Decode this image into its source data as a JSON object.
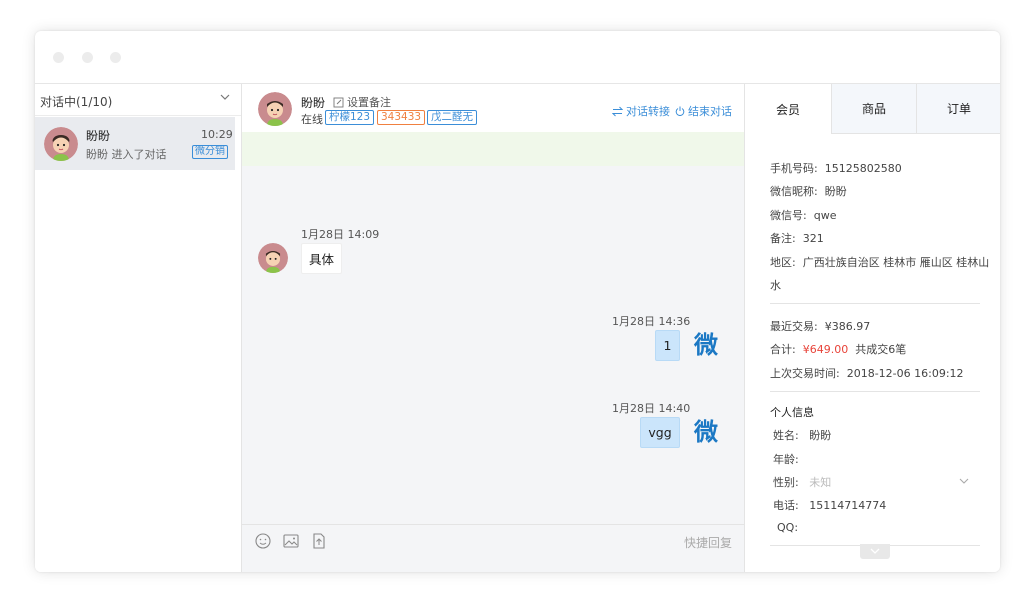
{
  "window": {
    "dots": [
      "",
      "",
      ""
    ]
  },
  "sidebar": {
    "header_label": "对话中(1/10)",
    "conversation": {
      "name": "盼盼",
      "time": "10:29",
      "message": "盼盼 进入了对话",
      "badge": "微分销"
    }
  },
  "chat": {
    "name": "盼盼",
    "note_label": "设置备注",
    "status": "在线",
    "tags": [
      "柠檬123",
      "343433",
      "戊二醛无"
    ],
    "transfer_label": "对话转接",
    "end_label": "结束对话",
    "messages": [
      {
        "time": "1月28日 14:09",
        "text": "具体",
        "direction": "in"
      },
      {
        "time": "1月28日 14:36",
        "text": "1",
        "direction": "out"
      },
      {
        "time": "1月28日 14:40",
        "text": "vgg",
        "direction": "out"
      }
    ],
    "agent_avatar_text": "微",
    "quick_reply_label": "快捷回复"
  },
  "panel": {
    "tabs": [
      "会员",
      "商品",
      "订单"
    ],
    "member": {
      "phone_label": "手机号码:",
      "phone": "15125802580",
      "nickname_label": "微信昵称:",
      "nickname": "盼盼",
      "wechat_label": "微信号:",
      "wechat": "qwe",
      "remark_label": "备注:",
      "remark": "321",
      "region_label": "地区:",
      "region_line1": "广西壮族自治区 桂林市 雁山区 桂林山",
      "region_line2": "水"
    },
    "trade": {
      "recent_label": "最近交易:",
      "recent": "¥386.97",
      "total_label": "合计:",
      "total": "¥649.00",
      "count": "共成交6笔",
      "last_label": "上次交易时间:",
      "last": "2018-12-06 16:09:12"
    },
    "personal": {
      "title": "个人信息",
      "name_label": "姓名:",
      "name": "盼盼",
      "age_label": "年龄:",
      "gender_label": "性别:",
      "gender": "未知",
      "tel_label": "电话:",
      "tel": "15114714774",
      "qq_label": "QQ:"
    }
  },
  "colors": {
    "accent": "#3b8ed8",
    "bubble_out": "#cbe5fb",
    "notice": "#f0f8ea",
    "price": "#e8443a",
    "tag_orange": "#f08040"
  }
}
